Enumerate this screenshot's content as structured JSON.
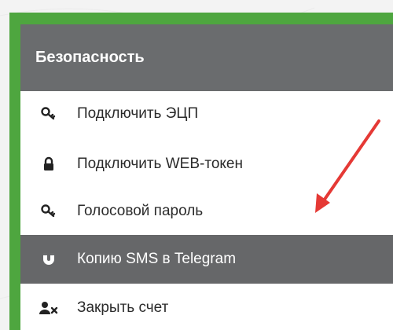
{
  "menu": {
    "header": "Безопасность",
    "items": [
      {
        "label": "Подключить ЭЦП",
        "icon": "key-icon",
        "active": false
      },
      {
        "label": "Подключить WEB-токен",
        "icon": "lock-icon",
        "active": false
      },
      {
        "label": "Голосовой пароль",
        "icon": "key-icon",
        "active": false
      },
      {
        "label": "Копию SMS в Telegram",
        "icon": "magnet-icon",
        "active": true
      },
      {
        "label": "Закрыть счет",
        "icon": "user-remove-icon",
        "active": false
      }
    ]
  },
  "colors": {
    "frame_green": "#4ea63f",
    "header_gray": "#6a6c6e",
    "active_gray": "#666769",
    "arrow_red": "#e53935"
  }
}
